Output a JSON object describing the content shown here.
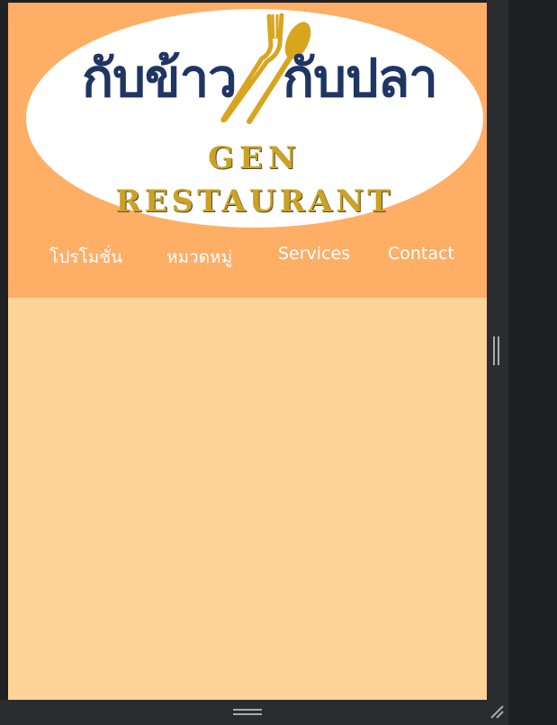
{
  "logo": {
    "thai_left": "กับข้าว",
    "thai_right": "กับปลา",
    "line1": "GEN",
    "line2": "RESTAURANT"
  },
  "nav": {
    "items": [
      {
        "label": "โปรโมชั่น"
      },
      {
        "label": "หมวดหมู่"
      },
      {
        "label": "Services"
      },
      {
        "label": "Contact"
      }
    ]
  },
  "colors": {
    "header_bg": "#ffae66",
    "content_bg": "#fed498",
    "logo_navy": "#1f3563",
    "logo_gold": "#c9a227",
    "chrome_dark": "#202124"
  }
}
